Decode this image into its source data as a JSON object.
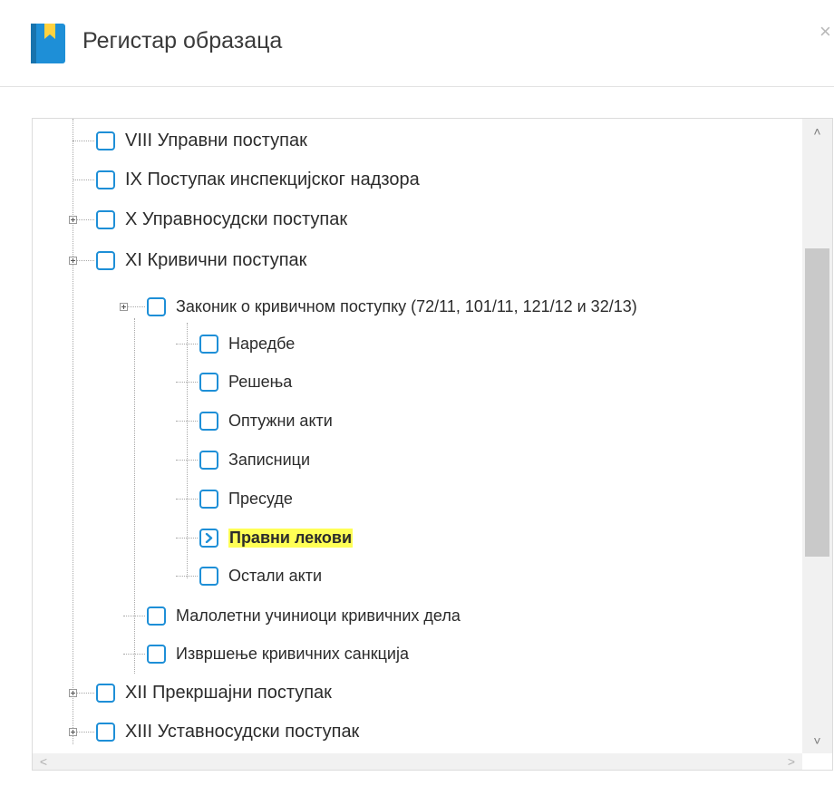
{
  "header": {
    "title": "Регистар образаца",
    "close_glyph": "×",
    "icon": "book-icon",
    "accent": "#1e8fd7"
  },
  "tree": {
    "items": [
      {
        "label": "VIII Управни поступак",
        "level": 0,
        "expandable": false
      },
      {
        "label": "IX Поступак инспекцијског надзора",
        "level": 0,
        "expandable": false
      },
      {
        "label": "X Управносудски поступак",
        "level": 0,
        "expandable": true
      },
      {
        "label": "XI Кривични поступак",
        "level": 0,
        "expandable": true
      },
      {
        "label": "Законик о кривичном поступку (72/11, 101/11, 121/12 и 32/13)",
        "level": 1,
        "expandable": true
      },
      {
        "label": "Наредбе",
        "level": 2,
        "expandable": false
      },
      {
        "label": "Решења",
        "level": 2,
        "expandable": false
      },
      {
        "label": "Оптужни акти",
        "level": 2,
        "expandable": false
      },
      {
        "label": "Записници",
        "level": 2,
        "expandable": false
      },
      {
        "label": "Пресуде",
        "level": 2,
        "expandable": false
      },
      {
        "label": "Правни лекови",
        "level": 2,
        "expandable": false,
        "selected": true,
        "highlight": "#ffff55"
      },
      {
        "label": "Остали акти",
        "level": 2,
        "expandable": false
      },
      {
        "label": "Малолетни учиниоци кривичних дела",
        "level": 1,
        "expandable": false
      },
      {
        "label": "Извршење кривичних санкција",
        "level": 1,
        "expandable": false
      },
      {
        "label": "XII Прекршајни поступак",
        "level": 0,
        "expandable": true
      },
      {
        "label": "XIII Уставносудски поступак",
        "level": 0,
        "expandable": true
      }
    ]
  },
  "scrollbars": {
    "up": "˄",
    "down": "˅",
    "left": "<",
    "right": ">"
  }
}
